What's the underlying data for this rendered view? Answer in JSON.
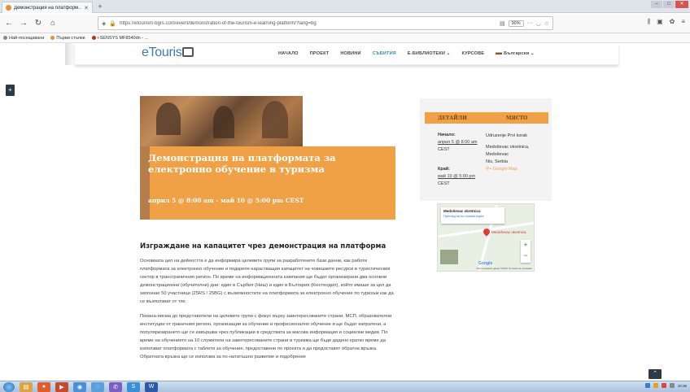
{
  "browser": {
    "tab_title": "Демонстрация на платформ…",
    "tab_close": "✕",
    "new_tab": "+",
    "url": "https://etourism-bgrs.com/event/demonstration-of-the-tourism-e-learning-platform/?lang=bg",
    "zoom": "90%",
    "bookmarks": [
      "Най-посещавани",
      "Първи стъпки",
      "i-SENSYS MF8540dn - ..."
    ]
  },
  "site": {
    "logo_text": "eTouris",
    "menu": [
      "НАЧАЛО",
      "ПРОЕКТ",
      "НОВИНИ",
      "СЪБИТИЯ",
      "Е-БИБЛИОТЕКИ ⌄",
      "КУРСОВЕ",
      "Български ⌄"
    ],
    "active_menu": "СЪБИТИЯ",
    "colors": {
      "accent": "#f0a045",
      "link": "#2d8fb0"
    }
  },
  "event": {
    "title": "Демонстрация на платформата за електронно обучение в туризма",
    "date_range": "април 5 @ 8:00 am - май 10 @ 5:00 pm CEST",
    "heading": "Изграждане на капацитет чрез демонстрация на платформа",
    "paragraph1": "Основната цел на дейността е да информира целевите групи за разработените бази данни, как работи платформата за електронно обучение и подкрепя нарастващия капацитет на човешките ресурси в туристическия сектор в трансграничния регион. По време на информационната кампания ще бъдат организирани два основни демонстрационни (обучителни) дни: един в Сърбия (Ниш) и един в България (Кюстендил), който имаше за цел да запознае 50 участници (25RS / 25BG) с възможностите на платформата за електронно обучение по туризъм как да се възползват от тях.",
    "paragraph2": "Покана-писма до представители на целевите групи с фокус върху заинтересованите страни, МСП, образователни институции от граничния регион, организации за обучение и професионално обучение и ще бъдат изпратени, а популяризирането ще се извършва чрез публикации в средствата за масова информация и социални медии. По време на обучението на 10 служители на заинтересованите страни в туризма ще бъде дадено кратко време да използват платформата с таблети за обучение, предоставени по проекта и да предоставят обратна връзка. Обратната връзка ще се използва за по-нататъшно развитие и подобрение"
  },
  "details": {
    "head_details": "ДЕТАЙЛИ",
    "head_place": "МЯСТО",
    "start_label": "Начало:",
    "start_value": "април 5 @ 8:00 am",
    "start_tz": "CEST",
    "end_label": "Край:",
    "end_value": "май 10 @ 5:00 pm",
    "end_tz": "CEST",
    "place_name": "Udruzenje Prvi korak",
    "place_addr1": "Medoševac okretnica,",
    "place_addr2": "Medoševac",
    "place_city": "Nis, Serbia",
    "gmap": "+ Google Map"
  },
  "map": {
    "info_name": "Medoševac okretnica",
    "info_link": "Преглед на по-голяма карта",
    "pin_label": "Medoševac okretnica",
    "google": "Google",
    "copyright": "Картографски данни ©2021  Условия за ползване",
    "zoom_in": "+",
    "zoom_out": "−"
  },
  "taskbar": {
    "clock": "10:36"
  }
}
